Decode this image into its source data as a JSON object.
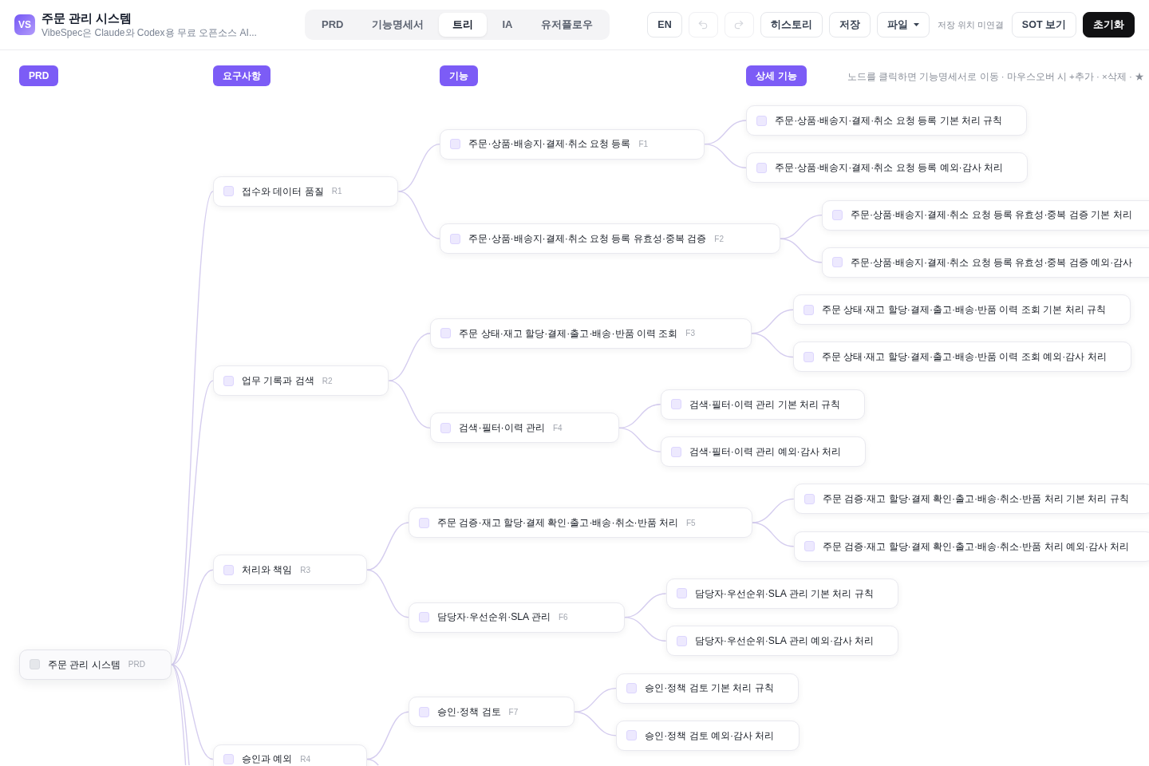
{
  "app": {
    "logo": "VS",
    "title": "주문 관리 시스템",
    "subtitle": "VibeSpec은 Claude와 Codex용 무료 오픈소스 AI..."
  },
  "tabs": [
    {
      "label": "PRD",
      "selected": false
    },
    {
      "label": "기능명세서",
      "selected": false
    },
    {
      "label": "트리",
      "selected": true
    },
    {
      "label": "IA",
      "selected": false
    },
    {
      "label": "유저플로우",
      "selected": false
    }
  ],
  "toolbar": [
    {
      "kind": "button",
      "label": "EN",
      "disabled": false
    },
    {
      "kind": "undo",
      "disabled": true
    },
    {
      "kind": "redo",
      "disabled": true
    },
    {
      "kind": "button",
      "label": "히스토리",
      "disabled": false
    },
    {
      "kind": "button",
      "label": "저장",
      "disabled": false
    },
    {
      "kind": "menu",
      "label": "파일",
      "disabled": false
    },
    {
      "kind": "note",
      "label": "저장 위치 미연결",
      "disabled": false
    },
    {
      "kind": "button",
      "label": "SOT 보기",
      "disabled": false
    },
    {
      "kind": "primary",
      "label": "초기화",
      "disabled": false
    }
  ],
  "canvas": {
    "columns": [
      "PRD",
      "요구사항",
      "기능",
      "상세 기능"
    ],
    "hint": "노드를 클릭하면 기능명세서로 이동 · 마우스오버 시 +추가 · ×삭제 · ★",
    "tree": {
      "label": "주문 관리 시스템",
      "tag": "PRD",
      "checked": false,
      "children": [
        {
          "label": "접수와 데이터 품질",
          "tag": "R1",
          "checked": false,
          "children": [
            {
              "label": "주문·상품·배송지·결제·취소 요청 등록",
              "tag": "F1",
              "checked": false,
              "children": [
                {
                  "label": "주문·상품·배송지·결제·취소 요청 등록 기본 처리 규칙",
                  "checked": false
                },
                {
                  "label": "주문·상품·배송지·결제·취소 요청 등록 예외·감사 처리",
                  "checked": false
                }
              ]
            },
            {
              "label": "주문·상품·배송지·결제·취소 요청 등록 유효성·중복 검증",
              "tag": "F2",
              "checked": false,
              "children": [
                {
                  "label": "주문·상품·배송지·결제·취소 요청 등록 유효성·중복 검증 기본 처리",
                  "checked": false
                },
                {
                  "label": "주문·상품·배송지·결제·취소 요청 등록 유효성·중복 검증 예외·감사",
                  "checked": false
                }
              ]
            }
          ]
        },
        {
          "label": "업무 기록과 검색",
          "tag": "R2",
          "checked": false,
          "children": [
            {
              "label": "주문 상태·재고 할당·결제·출고·배송·반품 이력 조회",
              "tag": "F3",
              "checked": false,
              "children": [
                {
                  "label": "주문 상태·재고 할당·결제·출고·배송·반품 이력 조회 기본 처리 규칙",
                  "checked": false
                },
                {
                  "label": "주문 상태·재고 할당·결제·출고·배송·반품 이력 조회 예외·감사 처리",
                  "checked": false
                }
              ]
            },
            {
              "label": "검색·필터·이력 관리",
              "tag": "F4",
              "checked": false,
              "children": [
                {
                  "label": "검색·필터·이력 관리 기본 처리 규칙",
                  "checked": false
                },
                {
                  "label": "검색·필터·이력 관리 예외·감사 처리",
                  "checked": false
                }
              ]
            }
          ]
        },
        {
          "label": "처리와 책임",
          "tag": "R3",
          "checked": false,
          "children": [
            {
              "label": "주문 검증·재고 할당·결제 확인·출고·배송·취소·반품 처리",
              "tag": "F5",
              "checked": false,
              "children": [
                {
                  "label": "주문 검증·재고 할당·결제 확인·출고·배송·취소·반품 처리 기본 처리 규칙",
                  "checked": false
                },
                {
                  "label": "주문 검증·재고 할당·결제 확인·출고·배송·취소·반품 처리 예외·감사 처리",
                  "checked": false
                }
              ]
            },
            {
              "label": "담당자·우선순위·SLA 관리",
              "tag": "F6",
              "checked": false,
              "children": [
                {
                  "label": "담당자·우선순위·SLA 관리 기본 처리 규칙",
                  "checked": false
                },
                {
                  "label": "담당자·우선순위·SLA 관리 예외·감사 처리",
                  "checked": false
                }
              ]
            }
          ]
        },
        {
          "label": "승인과 예외",
          "tag": "R4",
          "checked": false,
          "children": [
            {
              "label": "승인·정책 검토",
              "tag": "F7",
              "checked": false,
              "children": [
                {
                  "label": "승인·정책 검토 기본 처리 규칙",
                  "checked": false
                },
                {
                  "label": "승인·정책 검토 예외·감사 처리",
                  "checked": false
                }
              ]
            }
          ]
        }
      ]
    }
  }
}
